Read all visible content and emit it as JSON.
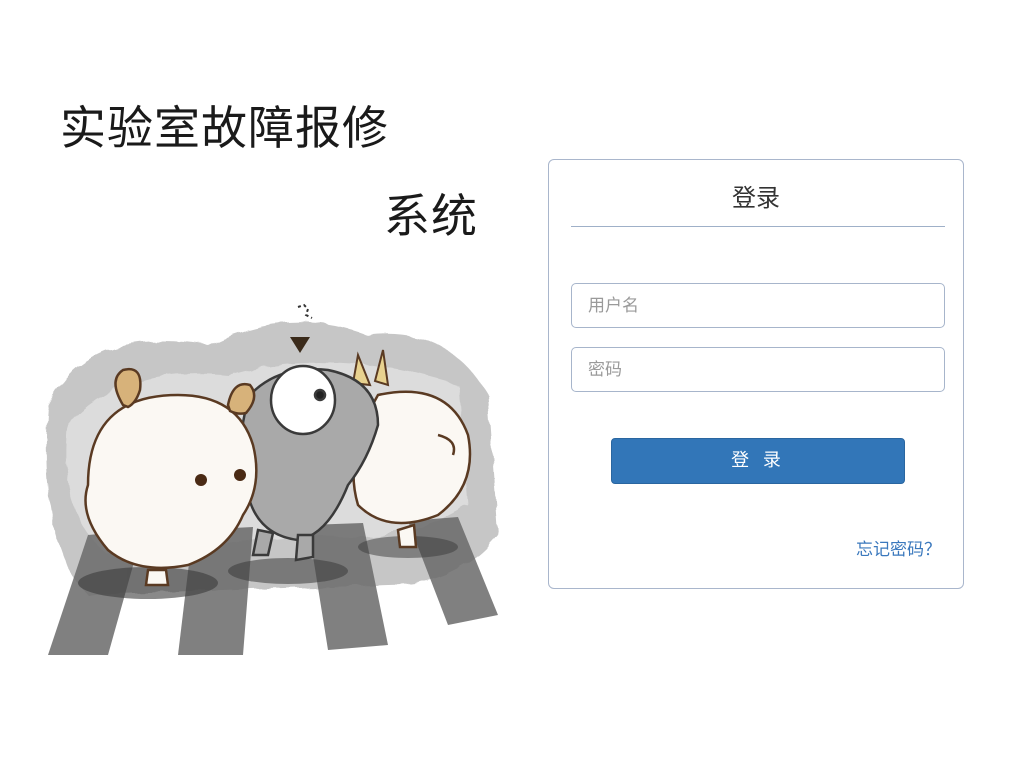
{
  "header": {
    "title_line1": "实验室故障报修",
    "title_line2": "系统"
  },
  "illustration": {
    "description_icon": "cartoon-sheep-illustration-icon"
  },
  "login": {
    "heading": "登录",
    "username_placeholder": "用户名",
    "password_placeholder": "密码",
    "submit_label": "登 录",
    "forgot_label": "忘记密码？"
  },
  "colors": {
    "primary_button": "#3276b8",
    "link": "#3a78bd",
    "panel_border": "#a9b6cc"
  }
}
